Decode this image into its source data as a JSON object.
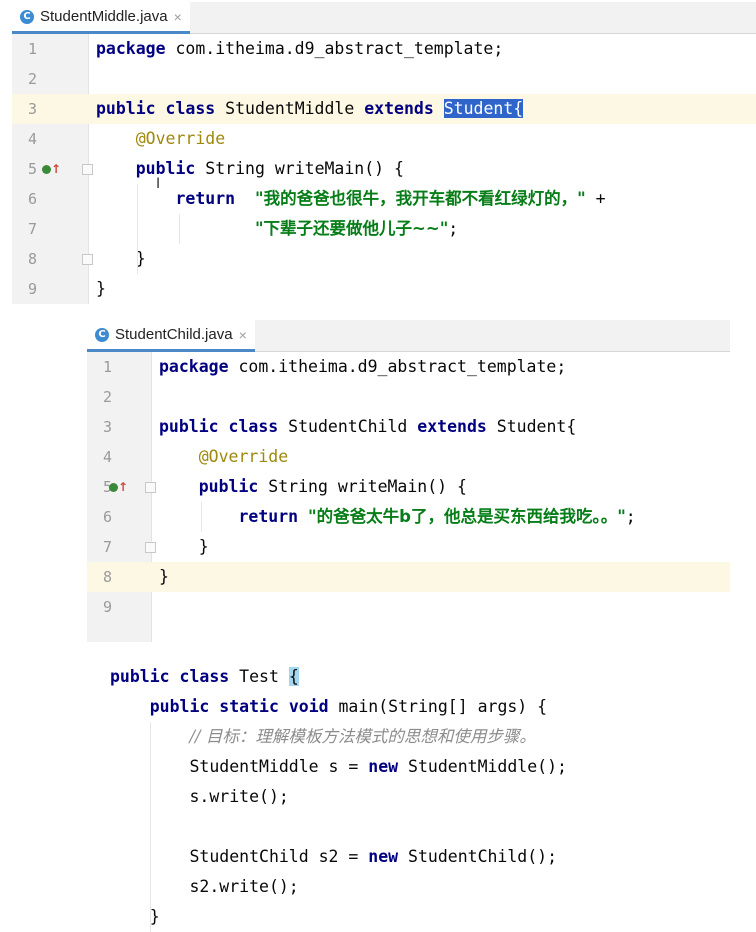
{
  "panel1": {
    "tab": {
      "icon": "class-icon",
      "icon_letter": "C",
      "filename": "StudentMiddle.java",
      "close": "×"
    },
    "lines": [
      {
        "n": "1",
        "parts": [
          [
            "kw",
            "package"
          ],
          [
            "t",
            " com.itheima.d9_abstract_template;"
          ]
        ]
      },
      {
        "n": "2",
        "parts": []
      },
      {
        "n": "3",
        "parts": [
          [
            "kw",
            "public class"
          ],
          [
            "t",
            " StudentMiddle "
          ],
          [
            "kw",
            "extends"
          ],
          [
            "t",
            " "
          ],
          [
            "sel",
            "Student{"
          ]
        ]
      },
      {
        "n": "4",
        "parts": [
          [
            "t",
            "    "
          ],
          [
            "ann",
            "@Override"
          ]
        ]
      },
      {
        "n": "5",
        "parts": [
          [
            "t",
            "    "
          ],
          [
            "kw",
            "public"
          ],
          [
            "t",
            " String writeMain() {"
          ]
        ]
      },
      {
        "n": "6",
        "parts": [
          [
            "t",
            "        "
          ],
          [
            "kw",
            "return"
          ],
          [
            "t",
            "  "
          ],
          [
            "str",
            "\"我的爸爸也很牛，我开车都不看红绿灯的，\""
          ],
          [
            "t",
            " +"
          ]
        ]
      },
      {
        "n": "7",
        "parts": [
          [
            "t",
            "                "
          ],
          [
            "str",
            "\"下辈子还要做他儿子~~\""
          ],
          [
            "t",
            ";"
          ]
        ]
      },
      {
        "n": "8",
        "parts": [
          [
            "t",
            "    }"
          ]
        ]
      },
      {
        "n": "9",
        "parts": [
          [
            "t",
            "}"
          ]
        ]
      }
    ]
  },
  "panel2": {
    "tab": {
      "icon": "class-icon",
      "icon_letter": "C",
      "filename": "StudentChild.java",
      "close": "×"
    },
    "lines": [
      {
        "n": "1",
        "parts": [
          [
            "kw",
            "package"
          ],
          [
            "t",
            " com.itheima.d9_abstract_template;"
          ]
        ]
      },
      {
        "n": "2",
        "parts": []
      },
      {
        "n": "3",
        "parts": [
          [
            "kw",
            "public class"
          ],
          [
            "t",
            " StudentChild "
          ],
          [
            "kw",
            "extends"
          ],
          [
            "t",
            " Student{"
          ]
        ]
      },
      {
        "n": "4",
        "parts": [
          [
            "t",
            "    "
          ],
          [
            "ann",
            "@Override"
          ]
        ]
      },
      {
        "n": "5",
        "parts": [
          [
            "t",
            "    "
          ],
          [
            "kw",
            "public"
          ],
          [
            "t",
            " String writeMain() {"
          ]
        ]
      },
      {
        "n": "6",
        "parts": [
          [
            "t",
            "        "
          ],
          [
            "kw",
            "return"
          ],
          [
            "t",
            " "
          ],
          [
            "str",
            "\"的爸爸太牛b了，他总是买东西给我吃。。\""
          ],
          [
            "t",
            ";"
          ]
        ]
      },
      {
        "n": "7",
        "parts": [
          [
            "t",
            "    }"
          ]
        ]
      },
      {
        "n": "8",
        "parts": [
          [
            "t",
            "}"
          ]
        ]
      },
      {
        "n": "9",
        "parts": []
      }
    ]
  },
  "panel3": {
    "lines": [
      {
        "parts": [
          [
            "kw",
            "public class"
          ],
          [
            "t",
            " Test "
          ],
          [
            "bh",
            "{"
          ]
        ]
      },
      {
        "parts": [
          [
            "t",
            "    "
          ],
          [
            "kw",
            "public static void"
          ],
          [
            "t",
            " main(String[] args) {"
          ]
        ]
      },
      {
        "parts": [
          [
            "t",
            "        "
          ],
          [
            "cmt",
            "// 目标：理解模板方法模式的思想和使用步骤。"
          ]
        ]
      },
      {
        "parts": [
          [
            "t",
            "        StudentMiddle s = "
          ],
          [
            "kw",
            "new"
          ],
          [
            "t",
            " StudentMiddle();"
          ]
        ]
      },
      {
        "parts": [
          [
            "t",
            "        s.write();"
          ]
        ]
      },
      {
        "parts": []
      },
      {
        "parts": [
          [
            "t",
            "        StudentChild s2 = "
          ],
          [
            "kw",
            "new"
          ],
          [
            "t",
            " StudentChild();"
          ]
        ]
      },
      {
        "parts": [
          [
            "t",
            "        s2.write();"
          ]
        ]
      },
      {
        "parts": [
          [
            "t",
            "    }"
          ]
        ]
      }
    ]
  },
  "colors": {
    "keyword": "#000080",
    "annotation": "#9e880d",
    "string": "#067d17",
    "selection": "#2f65ca",
    "current_line": "#fdf8e3"
  }
}
